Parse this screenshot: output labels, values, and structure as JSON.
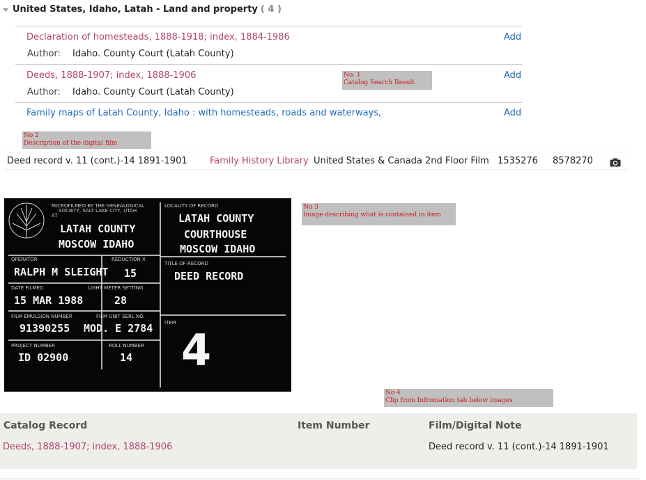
{
  "header": {
    "title": "United States, Idaho, Latah - Land and property",
    "count": "( 4 )"
  },
  "results": [
    {
      "title": "Declaration of homesteads, 1888-1918; index, 1884-1986",
      "add": "Add",
      "author_label": "Author:",
      "author": "Idaho. County Court (Latah County)"
    },
    {
      "title": "Deeds, 1888-1907; index, 1888-1906",
      "add": "Add",
      "author_label": "Author:",
      "author": "Idaho. County Court (Latah County)"
    },
    {
      "title": "Family maps of Latah County, Idaho : with homesteads, roads and waterways,",
      "add": "Add"
    }
  ],
  "annotations": {
    "a1_num": "No. 1",
    "a1_text": "Catalog Search Result",
    "a2_num": "No 2",
    "a2_text": "Description of the digital film",
    "a3_num": "No 3",
    "a3_text": "Image describing what is contained in item",
    "a4_num": "No 4",
    "a4_text": "Clip from Infromation tab below images"
  },
  "film_row": {
    "description": "Deed record v. 11 (cont.)-14 1891-1901",
    "library": "Family History Library",
    "location": "United States & Canada 2nd Floor Film",
    "film_number": "1535276",
    "dgs_number": "8578270",
    "camera_icon": "camera-icon"
  },
  "film_card": {
    "microfilmed_line1": "MICROFILMED BY THE GENEALOGICAL",
    "microfilmed_line2": "SOCIETY,  SALT LAKE CITY, UTAH",
    "microfilmed_line3": "AT",
    "left_place1": "LATAH COUNTY",
    "left_place2": "MOSCOW IDAHO",
    "locality_label": "LOCALITY OF RECORD",
    "locality1": "LATAH COUNTY",
    "locality2": "COURTHOUSE",
    "locality3": "MOSCOW IDAHO",
    "operator_label": "OPERATOR",
    "operator": "RALPH M SLEIGHT",
    "reduction_label": "REDUCTION X",
    "reduction": "15",
    "title_label": "TITLE OF RECORD",
    "title": "DEED RECORD",
    "date_label": "DATE FILMED",
    "date": "15 MAR 1988",
    "meter_label": "LIGHT METER SETTING",
    "meter": "28",
    "emulsion_label": "FILM EMULSION NUMBER",
    "emulsion": "91390255",
    "unit_label": "FILM UNIT SERL NO.",
    "unit": "MOD. E 2784",
    "item_label": "ITEM",
    "item": "4",
    "project_label": "PROJECT NUMBER",
    "project": "ID 02900",
    "roll_label": "ROLL NUMBER",
    "roll": "14"
  },
  "info_table": {
    "col1": "Catalog Record",
    "col2": "Item Number",
    "col3": "Film/Digital Note",
    "catalog_record": "Deeds, 1888-1907; index, 1888-1906",
    "item_number": "",
    "note": "Deed record v. 11 (cont.)-14 1891-1901"
  },
  "colors": {
    "link_magenta": "#b2456e",
    "link_blue": "#1e6bb8",
    "annotation_red": "#cc1a1a",
    "annotation_bg": "#c0c0c0",
    "info_bg": "#eeeeea"
  }
}
